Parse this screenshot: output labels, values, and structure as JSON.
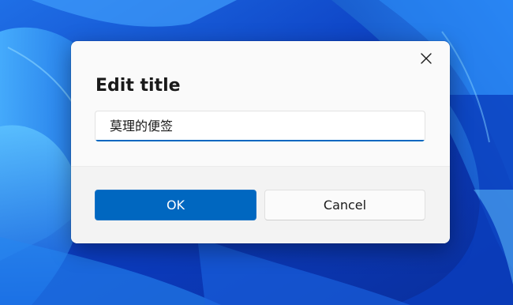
{
  "dialog": {
    "title": "Edit title",
    "close_icon": "close-icon",
    "input": {
      "value": "莫理的便签"
    },
    "buttons": {
      "ok_label": "OK",
      "cancel_label": "Cancel"
    }
  },
  "colors": {
    "accent": "#0067c0",
    "dialog_bg": "#fafafa",
    "footer_bg": "#f3f3f3",
    "wallpaper_base": "#0d3fc2"
  }
}
